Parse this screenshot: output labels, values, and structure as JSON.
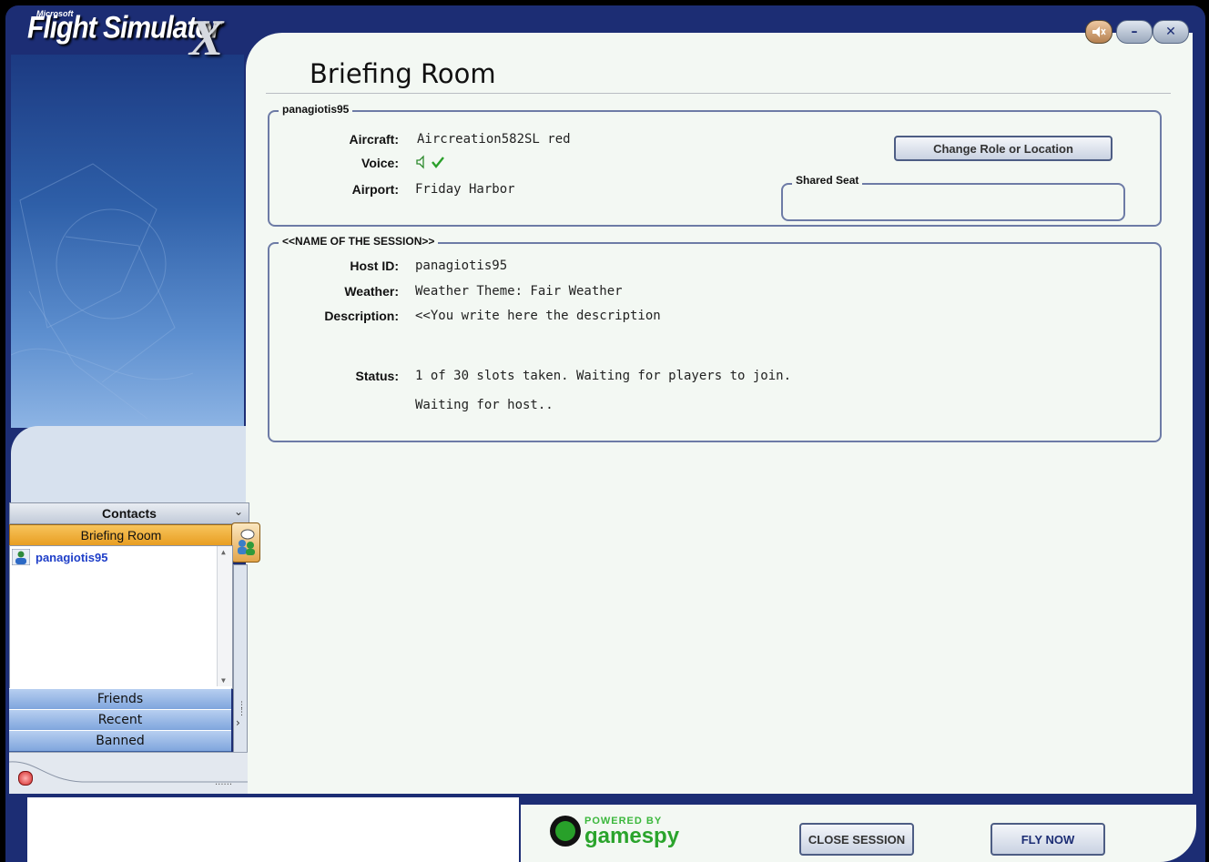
{
  "app": {
    "brand_small": "Microsoft",
    "brand_name": "Flight Simulator",
    "brand_x": "X"
  },
  "window_controls": {
    "sound_icon": "speaker-mute-icon",
    "minimize_label": "–",
    "close_label": "✕"
  },
  "page": {
    "title": "Briefing Room"
  },
  "player": {
    "legend": "panagiotis95",
    "aircraft_label": "Aircraft:",
    "aircraft_value": "Aircreation582SL red",
    "voice_label": "Voice:",
    "voice_icons": [
      "speaker-icon",
      "checkmark-icon"
    ],
    "airport_label": "Airport:",
    "airport_value": "Friday Harbor",
    "change_button": "Change Role or Location",
    "shared_seat_legend": "Shared Seat"
  },
  "session": {
    "legend": "<<NAME OF THE SESSION>>",
    "host_label": "Host ID:",
    "host_value": "panagiotis95",
    "weather_label": "Weather:",
    "weather_value": "Weather Theme: Fair Weather",
    "description_label": "Description:",
    "description_value": "<<You write here the description",
    "status_label": "Status:",
    "status_value": "1 of 30 slots taken. Waiting for players to join.",
    "status_sub": "Waiting for host.."
  },
  "contacts": {
    "header": "Contacts",
    "active_tab": "Briefing Room",
    "members": [
      {
        "name": "panagiotis95",
        "icon": "user-icon"
      }
    ],
    "categories": [
      "Friends",
      "Recent",
      "Banned"
    ]
  },
  "footer": {
    "powered_by": "POWERED BY",
    "gamespy": "gamespy",
    "close_session": "CLOSE SESSION",
    "fly_now": "FLY NOW"
  },
  "colors": {
    "frame": "#1c2d74",
    "content_bg": "#f3f8f3",
    "active_tab": "#f0b23a",
    "member_link": "#1e3ec8"
  }
}
